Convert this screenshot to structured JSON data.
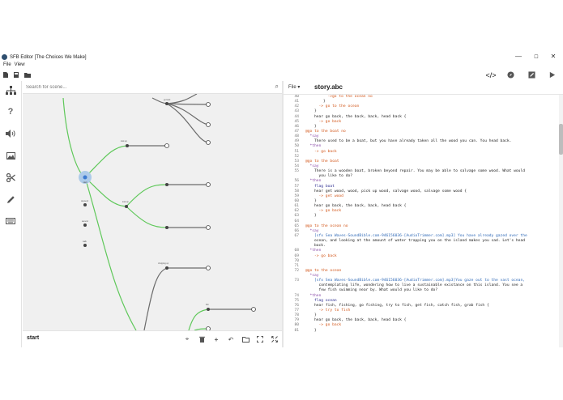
{
  "window": {
    "title": "SFB Editor [The Choices We Make]",
    "controls": {
      "minimize": "—",
      "maximize": "☐",
      "close": "✕"
    }
  },
  "menu": {
    "file": "File",
    "view": "View"
  },
  "search": {
    "placeholder": "Search for scene..."
  },
  "scene": {
    "current": "start"
  },
  "editor": {
    "file_menu": "File",
    "file_name": "story.abc",
    "lines": [
      {
        "n": "40",
        "indent": 10,
        "kind": "go",
        "text": "->go to the ocean no"
      },
      {
        "n": "41",
        "indent": 8,
        "kind": "plain",
        "text": "}"
      },
      {
        "n": "42",
        "indent": 6,
        "kind": "go",
        "text": "-> go to the ocean"
      },
      {
        "n": "43",
        "indent": 4,
        "kind": "plain",
        "text": "}"
      },
      {
        "n": "44",
        "indent": 4,
        "kind": "plain",
        "text": "hear go back, the back, back, head back {"
      },
      {
        "n": "45",
        "indent": 6,
        "kind": "go",
        "text": "-> go back"
      },
      {
        "n": "46",
        "indent": 4,
        "kind": "plain",
        "text": "}"
      },
      {
        "n": "47",
        "indent": 0,
        "kind": "knot",
        "text": "@go to the boat no"
      },
      {
        "n": "48",
        "indent": 2,
        "kind": "say",
        "text": "*say"
      },
      {
        "n": "49",
        "indent": 4,
        "kind": "plain",
        "text": "There used to be a boat, but you have already taken all the wood you can. You head back."
      },
      {
        "n": "50",
        "indent": 2,
        "kind": "then",
        "text": "*then"
      },
      {
        "n": "51",
        "indent": 4,
        "kind": "go",
        "text": "-> go back"
      },
      {
        "n": "52",
        "indent": 0,
        "kind": "plain",
        "text": ""
      },
      {
        "n": "53",
        "indent": 0,
        "kind": "knot",
        "text": "@go to the boat"
      },
      {
        "n": "54",
        "indent": 2,
        "kind": "say",
        "text": "*say"
      },
      {
        "n": "55",
        "indent": 4,
        "kind": "plain",
        "text": "There is a wooden boat, broken beyond repair. You may be able to salvage some wood. What would"
      },
      {
        "n": "",
        "indent": 6,
        "kind": "plain",
        "text": "you like to do?"
      },
      {
        "n": "56",
        "indent": 2,
        "kind": "then",
        "text": "*then"
      },
      {
        "n": "57",
        "indent": 4,
        "kind": "verb",
        "text": "flag boat"
      },
      {
        "n": "58",
        "indent": 4,
        "kind": "plain",
        "text": "hear get wood, wood, pick up wood, salvage wood, salvage some wood {"
      },
      {
        "n": "59",
        "indent": 6,
        "kind": "go",
        "text": "-> get wood"
      },
      {
        "n": "60",
        "indent": 4,
        "kind": "plain",
        "text": "}"
      },
      {
        "n": "61",
        "indent": 4,
        "kind": "plain",
        "text": "hear go back, the back, back, head back {"
      },
      {
        "n": "62",
        "indent": 6,
        "kind": "go",
        "text": "-> go back"
      },
      {
        "n": "63",
        "indent": 4,
        "kind": "plain",
        "text": "}"
      },
      {
        "n": "64",
        "indent": 0,
        "kind": "plain",
        "text": ""
      },
      {
        "n": "65",
        "indent": 0,
        "kind": "knot",
        "text": "@go to the ocean no"
      },
      {
        "n": "66",
        "indent": 2,
        "kind": "say",
        "text": "*say"
      },
      {
        "n": "67",
        "indent": 4,
        "kind": "sfx",
        "text": "[sfx Sea Waves-SoundBible.com-946156036-[AudioTrimmer.com].mp3] You have already gazed over the"
      },
      {
        "n": "",
        "indent": 4,
        "kind": "plain",
        "text": "ocean, and looking at the amount of water trapping you on the island makes you sad. Let's head"
      },
      {
        "n": "",
        "indent": 4,
        "kind": "plain",
        "text": "back."
      },
      {
        "n": "68",
        "indent": 2,
        "kind": "then",
        "text": "*then"
      },
      {
        "n": "69",
        "indent": 4,
        "kind": "go",
        "text": "-> go back"
      },
      {
        "n": "70",
        "indent": 0,
        "kind": "plain",
        "text": ""
      },
      {
        "n": "71",
        "indent": 0,
        "kind": "plain",
        "text": ""
      },
      {
        "n": "72",
        "indent": 0,
        "kind": "knot",
        "text": "@go to the ocean"
      },
      {
        "n": "",
        "indent": 2,
        "kind": "say",
        "text": "*say"
      },
      {
        "n": "73",
        "indent": 4,
        "kind": "sfx",
        "text": "[sfx Sea Waves-SoundBible.com-946156036-[AudioTrimmer.com].mp3]You gaze out to the vast ocean,"
      },
      {
        "n": "",
        "indent": 6,
        "kind": "plain",
        "text": "contemplating life, wondering how to live a sustainable existance on this island. You see a"
      },
      {
        "n": "",
        "indent": 6,
        "kind": "plain",
        "text": "few fish swimming near by. What would you like to do?"
      },
      {
        "n": "74",
        "indent": 2,
        "kind": "then",
        "text": "*then"
      },
      {
        "n": "75",
        "indent": 4,
        "kind": "verb",
        "text": "flag ocean"
      },
      {
        "n": "76",
        "indent": 4,
        "kind": "plain",
        "text": "hear fish, fishing, go fishing, try to fish, get fish, catch fish, grab fish {"
      },
      {
        "n": "77",
        "indent": 6,
        "kind": "go",
        "text": "-> try to fish"
      },
      {
        "n": "78",
        "indent": 4,
        "kind": "plain",
        "text": "}"
      },
      {
        "n": "79",
        "indent": 4,
        "kind": "plain",
        "text": "hear go back, the back, back, head back {"
      },
      {
        "n": "80",
        "indent": 6,
        "kind": "go",
        "text": "-> go back"
      },
      {
        "n": "81",
        "indent": 4,
        "kind": "plain",
        "text": "}"
      }
    ]
  },
  "graph": {
    "nodes": [
      {
        "id": "start",
        "label": "start"
      },
      {
        "id": "n_top",
        "label": "go back"
      },
      {
        "id": "n_boatno",
        "label": "look up"
      },
      {
        "id": "n_mid1",
        "label": "look up"
      },
      {
        "id": "n_left1",
        "label": "descend"
      },
      {
        "id": "n_left2",
        "label": "ascend"
      },
      {
        "id": "n_left3",
        "label": "walk"
      },
      {
        "id": "n_low",
        "label": "chopping up"
      },
      {
        "id": "n_bottom",
        "label": "fish"
      }
    ],
    "edge_colors": {
      "active": "#5fc85a",
      "inactive": "#6b6b6b"
    }
  },
  "icons": {
    "sidebar": [
      "scene-tree-icon",
      "help-icon",
      "audio-icon",
      "image-icon",
      "scissors-icon",
      "pen-icon",
      "keyboard-icon"
    ],
    "tools": [
      "code-icon",
      "compass-icon",
      "edit-icon",
      "play-icon"
    ],
    "bottom": [
      "target-icon",
      "trash-icon",
      "add-icon",
      "undo-icon",
      "folder-icon",
      "fit-icon",
      "expand-icon"
    ]
  }
}
